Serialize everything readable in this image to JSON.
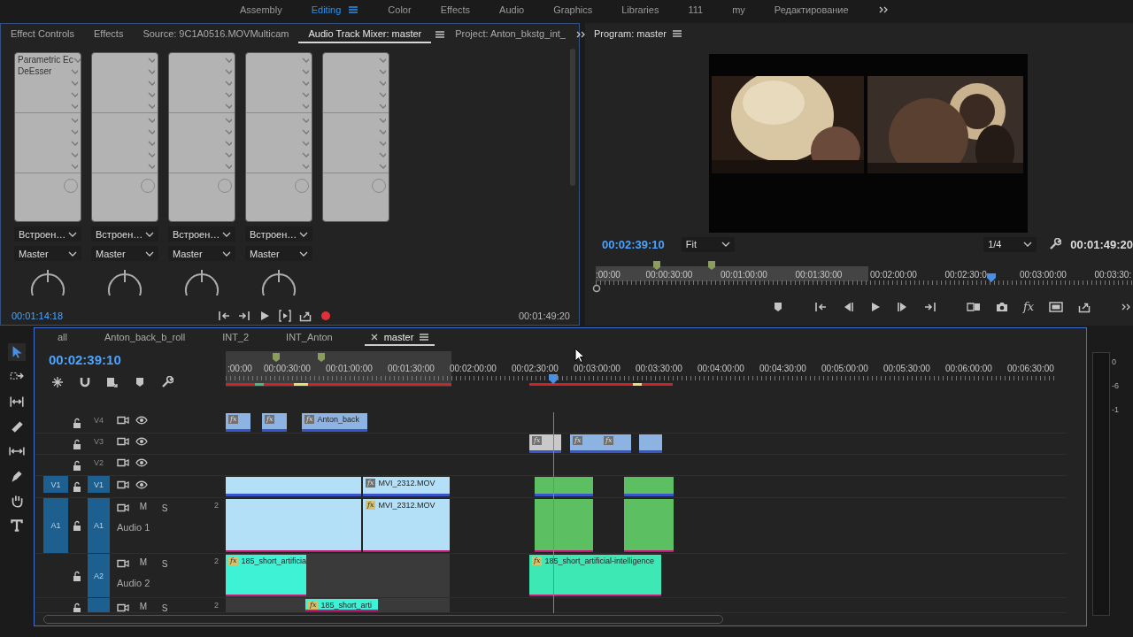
{
  "workspaces": [
    {
      "label": "Assembly",
      "selected": false,
      "menu": false
    },
    {
      "label": "Editing",
      "selected": true,
      "menu": true
    },
    {
      "label": "Color",
      "selected": false,
      "menu": false
    },
    {
      "label": "Effects",
      "selected": false,
      "menu": false
    },
    {
      "label": "Audio",
      "selected": false,
      "menu": false
    },
    {
      "label": "Graphics",
      "selected": false,
      "menu": false
    },
    {
      "label": "Libraries",
      "selected": false,
      "menu": false
    },
    {
      "label": "111",
      "selected": false,
      "menu": false
    },
    {
      "label": "my",
      "selected": false,
      "menu": false
    },
    {
      "label": "Редактирование",
      "selected": false,
      "menu": false
    }
  ],
  "source_panel": {
    "tabs": [
      {
        "label": "Effect Controls",
        "selected": false
      },
      {
        "label": "Effects",
        "selected": false
      },
      {
        "label": "Source: 9C1A0516.MOVMulticam",
        "selected": false
      },
      {
        "label": "Audio Track Mixer: master",
        "selected": true
      },
      {
        "label": "Project: Anton_bkstg_int_",
        "selected": false
      }
    ],
    "channels": [
      {
        "kind": "track",
        "effects": [
          "Parametric Ec",
          "DeEsser"
        ],
        "input": "Встроен…",
        "output": "Master"
      },
      {
        "kind": "track",
        "input": "Встроен…",
        "output": "Master"
      },
      {
        "kind": "track",
        "input": "Встроен…",
        "output": "Master"
      },
      {
        "kind": "track",
        "input": "Встроен…",
        "output": "Master"
      },
      {
        "kind": "master"
      }
    ],
    "current_time": "00:01:14:18",
    "duration": "00:01:49:20"
  },
  "program_monitor": {
    "title": "Program: master",
    "timecode": "00:02:39:10",
    "zoom": "Fit",
    "resolution": "1/4",
    "duration": "00:01:49:20",
    "ruler_labels": [
      ":00:00",
      "00:00:30:00",
      "00:01:00:00",
      "00:01:30:00",
      "00:02:00:00",
      "00:02:30:0",
      "00:03:00:00",
      "00:03:30:"
    ],
    "playhead": {
      "level": 0.735
    },
    "fx_label": "fx"
  },
  "tools": [
    {
      "selected": true
    },
    {
      "selected": false
    },
    {
      "selected": false
    },
    {
      "selected": false
    },
    {
      "selected": false
    },
    {
      "selected": false
    },
    {
      "selected": false
    },
    {
      "selected": false
    }
  ],
  "timeline": {
    "tabs": [
      {
        "label": "all",
        "selected": false,
        "closable": false
      },
      {
        "label": "Anton_back_b_roll",
        "selected": false,
        "closable": false
      },
      {
        "label": "INT_2",
        "selected": false,
        "closable": false
      },
      {
        "label": "INT_Anton",
        "selected": false,
        "closable": false
      },
      {
        "label": "master",
        "selected": true,
        "closable": true
      }
    ],
    "timecode": "00:02:39:10",
    "ruler_labels": [
      ":00:00",
      "00:00:30:00",
      "00:01:00:00",
      "00:01:30:00",
      "00:02:00:00",
      "00:02:30:00",
      "00:03:00:00",
      "00:03:30:00",
      "00:04:00:00",
      "00:04:30:00",
      "00:05:00:00",
      "00:05:30:00",
      "00:06:00:00",
      "00:06:30:00"
    ],
    "playhead": {
      "level": 0.389
    },
    "tracks": [
      {
        "kind": "video",
        "target": "V4",
        "targeted": false,
        "clips": [
          {
            "color": "#8db3e2",
            "badge": "fx"
          },
          {
            "color": "#8db3e2",
            "badge": "fx"
          },
          {
            "color": "#8db3e2",
            "badge": "fx",
            "label": "Anton_back"
          }
        ]
      },
      {
        "kind": "video",
        "target": "V3",
        "targeted": false,
        "clips": [
          {
            "color": "#c9c9c9",
            "badge": "fx"
          },
          {
            "color": "#8db3e2",
            "badge": "fx"
          },
          {
            "color": "#8db3e2",
            "badge": "fx"
          },
          {
            "color": "#8db3e2"
          }
        ]
      },
      {
        "kind": "video",
        "target": "V2",
        "targeted": false
      },
      {
        "kind": "video",
        "source": "V1",
        "target": "V1",
        "targeted": true,
        "clips": [
          {
            "color": "#b3e0f7"
          },
          {
            "color": "#b3e0f7",
            "badge": "fx",
            "label": "MVI_2312.MOV"
          },
          {
            "color": "#5cbf62"
          },
          {
            "color": "#5cbf62"
          }
        ]
      },
      {
        "kind": "audio",
        "source": "A1",
        "target": "A1",
        "targeted": true,
        "name": "Audio 1",
        "mute": "M",
        "solo": "S",
        "channels": "2",
        "clips": [
          {
            "color": "#b3e0f7"
          },
          {
            "color": "#b3e0f7",
            "badge": "fx",
            "label": "MVI_2312.MOV"
          },
          {
            "color": "#5cbf62"
          },
          {
            "color": "#5cbf62"
          }
        ]
      },
      {
        "kind": "audio",
        "target": "A2",
        "targeted": true,
        "name": "Audio 2",
        "mute": "M",
        "solo": "S",
        "channels": "2",
        "clips": [
          {
            "color": "#3ef2d6",
            "badge": "fx",
            "label": "185_short_artificia"
          },
          {
            "color": "#3ee8b4",
            "badge": "fx",
            "label": "185_short_artificial-intelligence"
          }
        ]
      },
      {
        "kind": "audio",
        "targeted": true,
        "mute": "M",
        "solo": "S",
        "channels": "2",
        "clips": [
          {
            "color": "#3ef2d6",
            "badge": "fx",
            "label": "185_short_arti"
          }
        ]
      }
    ]
  },
  "meter_scale": [
    "0",
    "-6",
    "-1"
  ]
}
